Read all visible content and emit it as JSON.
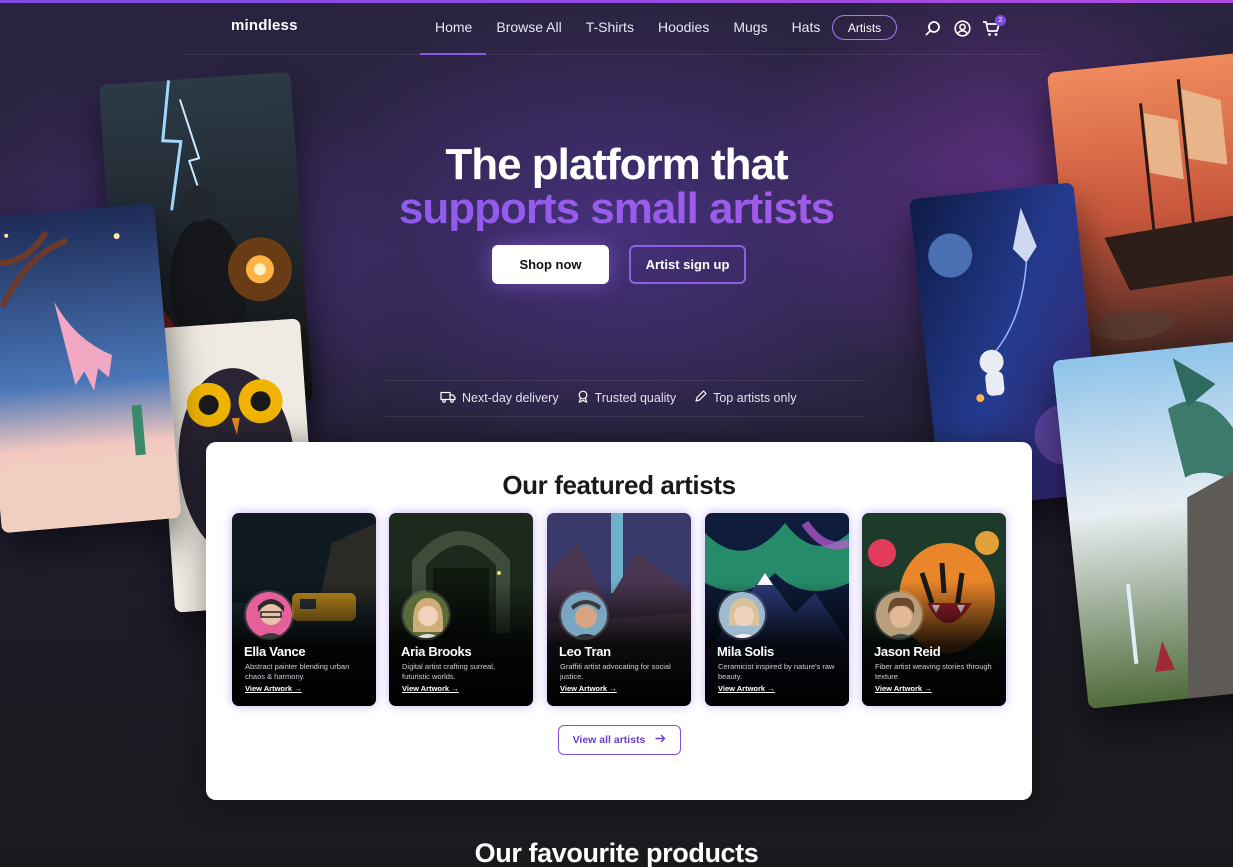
{
  "nav": {
    "logo": "mindless",
    "links": [
      "Home",
      "Browse All",
      "T-Shirts",
      "Hoodies",
      "Mugs",
      "Hats"
    ],
    "artists": "Artists",
    "cart_count": "2",
    "icons": [
      "search-icon",
      "account-icon",
      "cart-icon"
    ]
  },
  "hero": {
    "title_line1": "The platform that",
    "title_line2": "supports small artists",
    "shop_button": "Shop now",
    "signup_button": "Artist sign up"
  },
  "perks": [
    {
      "icon": "truck-icon",
      "label": "Next-day delivery"
    },
    {
      "icon": "ribbon-icon",
      "label": "Trusted quality"
    },
    {
      "icon": "pencil-icon",
      "label": "Top artists only"
    }
  ],
  "featured": {
    "title": "Our featured artists",
    "link_label": "View Artwork",
    "artists": [
      {
        "name": "Ella Vance",
        "bio": "Abstract painter blending urban chaos & harmony."
      },
      {
        "name": "Aria Brooks",
        "bio": "Digital artist crafting surreal, futuristic worlds."
      },
      {
        "name": "Leo Tran",
        "bio": "Graffiti artist advocating for social justice."
      },
      {
        "name": "Mila Solis",
        "bio": "Ceramicist inspired by nature's raw beauty."
      },
      {
        "name": "Jason Reid",
        "bio": "Fiber artist weaving stories through texture."
      }
    ],
    "view_all": "View all artists"
  },
  "favourites": {
    "title": "Our favourite products"
  },
  "colors": {
    "accent": "#7d52e6",
    "accent2": "#b35ae8",
    "panel": "#ffffff"
  }
}
